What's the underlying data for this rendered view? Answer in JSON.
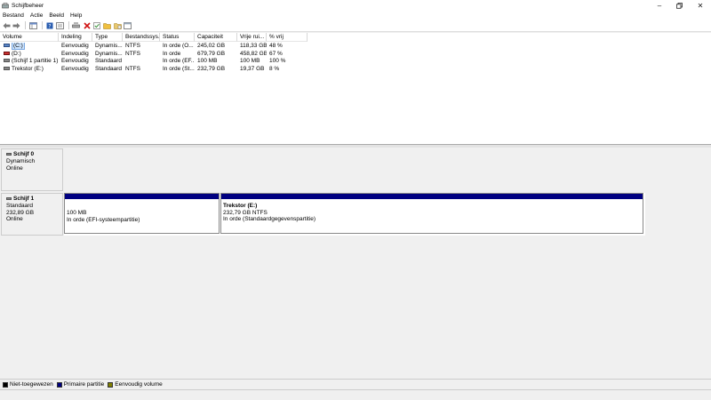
{
  "window": {
    "title": "Schijfbeheer"
  },
  "menu": [
    "Bestand",
    "Actie",
    "Beeld",
    "Help"
  ],
  "toolbar": [
    "back-icon",
    "forward-icon",
    "console-tree-icon",
    "help-icon",
    "properties-icon",
    "connect-icon",
    "delete-icon",
    "check-icon",
    "folder-open-icon",
    "folder-icon",
    "window-icon"
  ],
  "columns": [
    "Volume",
    "Indeling",
    "Type",
    "Bestandssys...",
    "Status",
    "Capaciteit",
    "Vrije rui...",
    "% vrij"
  ],
  "volumes": [
    [
      "(C:)",
      "Eenvoudig",
      "Dynamis...",
      "NTFS",
      "In orde (O...",
      "245,02 GB",
      "118,33 GB",
      "48 %"
    ],
    [
      "(D:)",
      "Eenvoudig",
      "Dynamis...",
      "NTFS",
      "In orde",
      "679,79 GB",
      "458,82 GB",
      "67 %"
    ],
    [
      "(Schijf 1 partitie 1)",
      "Eenvoudig",
      "Standaard",
      "",
      "In orde (EF...",
      "100 MB",
      "100 MB",
      "100 %"
    ],
    [
      "Trekstor (E:)",
      "Eenvoudig",
      "Standaard",
      "NTFS",
      "In orde (St...",
      "232,79 GB",
      "19,37 GB",
      "8 %"
    ]
  ],
  "disks": [
    {
      "name": "Schijf 0",
      "type": "Dynamisch",
      "size": "",
      "status": "Online",
      "partitions": []
    },
    {
      "name": "Schijf 1",
      "type": "Standaard",
      "size": "232,89 GB",
      "status": "Online",
      "partitions": [
        {
          "label": "",
          "size": "100 MB",
          "status": "In orde (EFI-systeempartitie)"
        },
        {
          "label": "Trekstor  (E:)",
          "size": "232,79 GB NTFS",
          "status": "In orde (Standaardgegevenspartitie)"
        }
      ]
    }
  ],
  "legend": [
    {
      "label": "Niet-toegewezen",
      "color": "#000000"
    },
    {
      "label": "Primaire partitie",
      "color": "#000080"
    },
    {
      "label": "Eenvoudig volume",
      "color": "#808000"
    }
  ]
}
